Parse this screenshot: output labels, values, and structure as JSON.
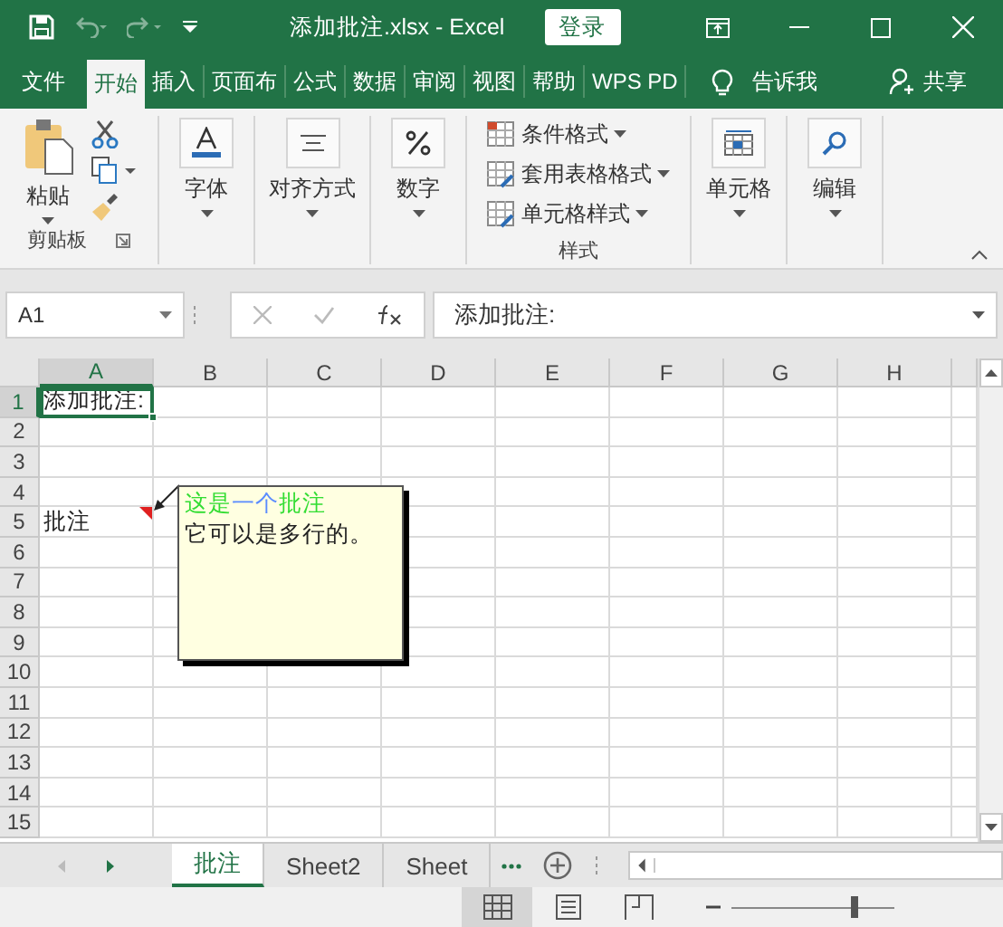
{
  "window": {
    "title": "添加批注.xlsx  -  Excel",
    "sign_in": "登录"
  },
  "tabs": [
    {
      "label": "文件",
      "selected": false
    },
    {
      "label": "开始",
      "selected": true
    },
    {
      "label": "插入",
      "selected": false
    },
    {
      "label": "页面布",
      "selected": false
    },
    {
      "label": "公式",
      "selected": false
    },
    {
      "label": "数据",
      "selected": false
    },
    {
      "label": "审阅",
      "selected": false
    },
    {
      "label": "视图",
      "selected": false
    },
    {
      "label": "帮助",
      "selected": false
    },
    {
      "label": "WPS PD",
      "selected": false
    }
  ],
  "tell_me": "告诉我",
  "share": "共享",
  "ribbon": [
    {
      "kind": "clipboard",
      "button": "粘贴",
      "label": "剪贴板"
    },
    {
      "kind": "font",
      "button": "字体"
    },
    {
      "kind": "align",
      "button": "对齐方式"
    },
    {
      "kind": "number",
      "button": "数字"
    },
    {
      "kind": "styles",
      "items": [
        "条件格式",
        "套用表格格式",
        "单元格样式"
      ],
      "label": "样式"
    },
    {
      "kind": "cells",
      "button": "单元格"
    },
    {
      "kind": "edit",
      "button": "编辑"
    }
  ],
  "formula_bar": {
    "name_box": "A1",
    "formula": "添加批注:"
  },
  "columns": [
    {
      "label": "A",
      "selected": true
    },
    {
      "label": "B",
      "selected": false
    },
    {
      "label": "C",
      "selected": false
    },
    {
      "label": "D",
      "selected": false
    },
    {
      "label": "E",
      "selected": false
    },
    {
      "label": "F",
      "selected": false
    },
    {
      "label": "G",
      "selected": false
    },
    {
      "label": "H",
      "selected": false
    }
  ],
  "rows": [
    {
      "label": "1",
      "selected": true,
      "cell": "添加批注:",
      "has_comment": false
    },
    {
      "label": "2",
      "selected": false
    },
    {
      "label": "3",
      "selected": false
    },
    {
      "label": "4",
      "selected": false
    },
    {
      "label": "5",
      "selected": false,
      "cell": "批注",
      "has_comment": true
    },
    {
      "label": "6",
      "selected": false
    },
    {
      "label": "7",
      "selected": false
    },
    {
      "label": "8",
      "selected": false
    },
    {
      "label": "9",
      "selected": false
    },
    {
      "label": "10",
      "selected": false
    },
    {
      "label": "11",
      "selected": false
    },
    {
      "label": "12",
      "selected": false
    },
    {
      "label": "13",
      "selected": false
    },
    {
      "label": "14",
      "selected": false
    },
    {
      "label": "15",
      "selected": false
    }
  ],
  "comment": {
    "first_line": [
      {
        "text": "这是",
        "color": "#33dd33"
      },
      {
        "text": "一个",
        "color": "#5b8cff"
      },
      {
        "text": "批注",
        "color": "#33dd33"
      }
    ],
    "second_line": "它可以是多行的。"
  },
  "sheet_tabs": [
    {
      "label": "批注",
      "selected": true
    },
    {
      "label": "Sheet2",
      "selected": false
    },
    {
      "label": "Sheet",
      "selected": false
    }
  ],
  "status_views": [
    {
      "kind": "normal",
      "selected": true
    },
    {
      "kind": "page",
      "selected": false
    },
    {
      "kind": "break",
      "selected": false
    }
  ],
  "zoom": {
    "level": 0.75
  }
}
